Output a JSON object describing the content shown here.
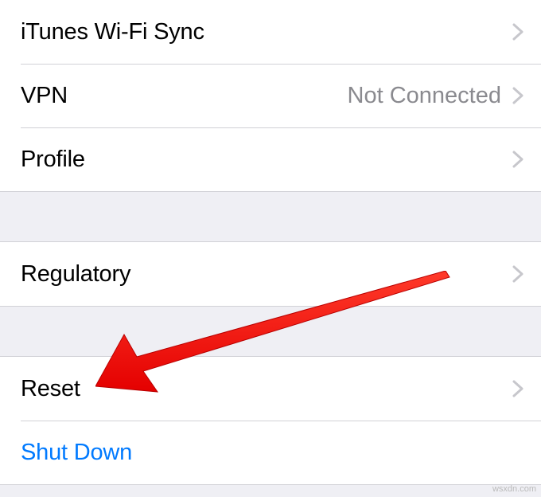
{
  "top_group": {
    "itunes_wifi_sync": {
      "label": "iTunes Wi-Fi Sync"
    },
    "vpn": {
      "label": "VPN",
      "detail": "Not Connected"
    },
    "profile": {
      "label": "Profile"
    }
  },
  "regulatory_group": {
    "regulatory": {
      "label": "Regulatory"
    }
  },
  "bottom_group": {
    "reset": {
      "label": "Reset"
    },
    "shutdown": {
      "label": "Shut Down"
    }
  },
  "watermark": "wsxdn.com"
}
